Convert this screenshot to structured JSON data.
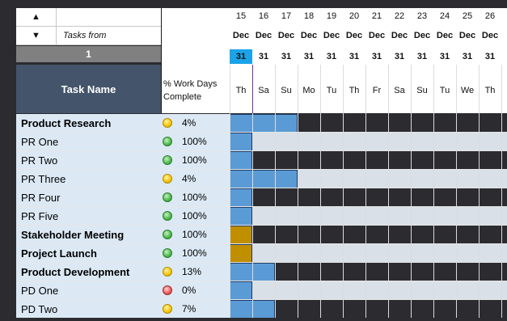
{
  "controls": {
    "up_arrow": "▲",
    "down_arrow": "▼",
    "tasks_from_label": "Tasks from",
    "start_index": "1"
  },
  "headers": {
    "task_name": "Task Name",
    "pct_line1": "% Work Days",
    "pct_line2": "Complete"
  },
  "dates": [
    {
      "num": "15",
      "mon": "Dec",
      "day": "31",
      "wd": "Th",
      "today": true
    },
    {
      "num": "16",
      "mon": "Dec",
      "day": "31",
      "wd": "Sa",
      "today": false
    },
    {
      "num": "17",
      "mon": "Dec",
      "day": "31",
      "wd": "Su",
      "today": false
    },
    {
      "num": "18",
      "mon": "Dec",
      "day": "31",
      "wd": "Mo",
      "today": false
    },
    {
      "num": "19",
      "mon": "Dec",
      "day": "31",
      "wd": "Tu",
      "today": false
    },
    {
      "num": "20",
      "mon": "Dec",
      "day": "31",
      "wd": "Th",
      "today": false
    },
    {
      "num": "21",
      "mon": "Dec",
      "day": "31",
      "wd": "Fr",
      "today": false
    },
    {
      "num": "22",
      "mon": "Dec",
      "day": "31",
      "wd": "Sa",
      "today": false
    },
    {
      "num": "23",
      "mon": "Dec",
      "day": "31",
      "wd": "Su",
      "today": false
    },
    {
      "num": "24",
      "mon": "Dec",
      "day": "31",
      "wd": "Tu",
      "today": false
    },
    {
      "num": "25",
      "mon": "Dec",
      "day": "31",
      "wd": "We",
      "today": false
    },
    {
      "num": "26",
      "mon": "Dec",
      "day": "31",
      "wd": "Th",
      "today": false
    }
  ],
  "tasks": [
    {
      "name": "Product Research",
      "bold": true,
      "status": "yellow",
      "pct": "4%",
      "bar_start": 0,
      "bar_len": 3,
      "bar_color": "blue"
    },
    {
      "name": "PR One",
      "bold": false,
      "status": "green",
      "pct": "100%",
      "bar_start": 0,
      "bar_len": 1,
      "bar_color": "blue"
    },
    {
      "name": "PR Two",
      "bold": false,
      "status": "green",
      "pct": "100%",
      "bar_start": 0,
      "bar_len": 1,
      "bar_color": "blue"
    },
    {
      "name": "PR Three",
      "bold": false,
      "status": "yellow",
      "pct": "4%",
      "bar_start": 0,
      "bar_len": 3,
      "bar_color": "blue"
    },
    {
      "name": "PR Four",
      "bold": false,
      "status": "green",
      "pct": "100%",
      "bar_start": 0,
      "bar_len": 1,
      "bar_color": "blue"
    },
    {
      "name": "PR Five",
      "bold": false,
      "status": "green",
      "pct": "100%",
      "bar_start": 0,
      "bar_len": 1,
      "bar_color": "blue"
    },
    {
      "name": "Stakeholder Meeting",
      "bold": true,
      "status": "green",
      "pct": "100%",
      "bar_start": 0,
      "bar_len": 1,
      "bar_color": "gold"
    },
    {
      "name": "Project Launch",
      "bold": true,
      "status": "green",
      "pct": "100%",
      "bar_start": 0,
      "bar_len": 1,
      "bar_color": "gold"
    },
    {
      "name": "Product Development",
      "bold": true,
      "status": "yellow",
      "pct": "13%",
      "bar_start": 0,
      "bar_len": 2,
      "bar_color": "blue"
    },
    {
      "name": "PD One",
      "bold": false,
      "status": "red",
      "pct": "0%",
      "bar_start": 0,
      "bar_len": 1,
      "bar_color": "blue"
    },
    {
      "name": "PD Two",
      "bold": false,
      "status": "yellow",
      "pct": "7%",
      "bar_start": 0,
      "bar_len": 2,
      "bar_color": "blue"
    }
  ],
  "colors": {
    "header_dark": "#44546a",
    "task_bg": "#dce9f5",
    "bar_blue": "#5b9bd5",
    "bar_gold": "#bf8f00",
    "today": "#1aa3e8"
  }
}
